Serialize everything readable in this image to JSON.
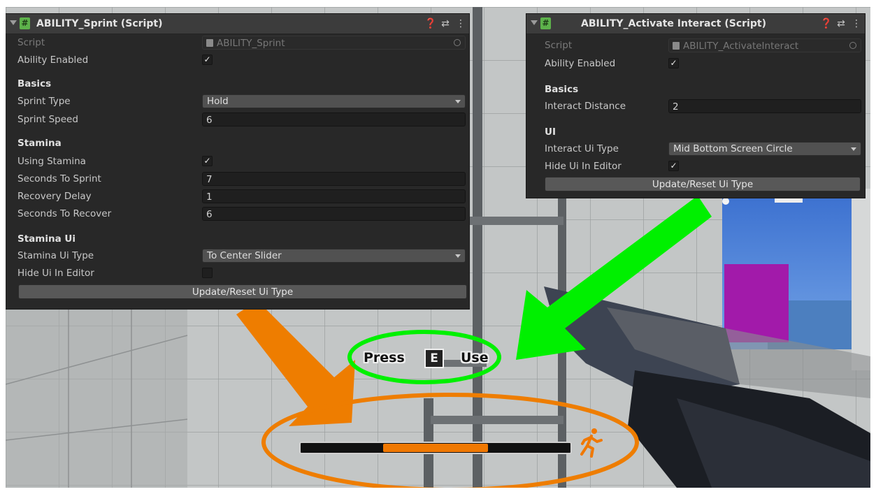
{
  "sprint_panel": {
    "title": "ABILITY_Sprint (Script)",
    "script_label": "Script",
    "script_value": "ABILITY_Sprint",
    "ability_enabled_label": "Ability Enabled",
    "ability_enabled": true,
    "basics_header": "Basics",
    "sprint_type_label": "Sprint Type",
    "sprint_type_value": "Hold",
    "sprint_speed_label": "Sprint Speed",
    "sprint_speed_value": "6",
    "stamina_header": "Stamina",
    "using_stamina_label": "Using Stamina",
    "using_stamina": true,
    "seconds_to_sprint_label": "Seconds To Sprint",
    "seconds_to_sprint_value": "7",
    "recovery_delay_label": "Recovery Delay",
    "recovery_delay_value": "1",
    "seconds_to_recover_label": "Seconds To Recover",
    "seconds_to_recover_value": "6",
    "stamina_ui_header": "Stamina Ui",
    "stamina_ui_type_label": "Stamina Ui Type",
    "stamina_ui_type_value": "To Center Slider",
    "hide_ui_label": "Hide Ui In Editor",
    "hide_ui": false,
    "update_button": "Update/Reset Ui Type"
  },
  "interact_panel": {
    "title": "ABILITY_Activate Interact (Script)",
    "script_label": "Script",
    "script_value": "ABILITY_ActivateInteract",
    "ability_enabled_label": "Ability Enabled",
    "ability_enabled": true,
    "basics_header": "Basics",
    "interact_distance_label": "Interact Distance",
    "interact_distance_value": "2",
    "ui_header": "UI",
    "interact_ui_type_label": "Interact Ui Type",
    "interact_ui_type_value": "Mid Bottom Screen Circle",
    "hide_ui_label": "Hide Ui In Editor",
    "hide_ui": true,
    "update_button": "Update/Reset Ui Type"
  },
  "hud": {
    "press_label": "Press",
    "key_label": "E",
    "use_label": "Use",
    "stamina_fill": 0.39,
    "stamina_center": 0.5
  },
  "header_icons": [
    "help-icon",
    "preset-icon",
    "kebab-menu-icon"
  ],
  "colors": {
    "stamina_orange": "#f07800",
    "green_highlight": "#00f000",
    "orange_highlight": "#ee7d00",
    "purple_cube": "#a21aaa",
    "inspector_bg": "#282828",
    "script_icon_green": "#5db24b"
  }
}
